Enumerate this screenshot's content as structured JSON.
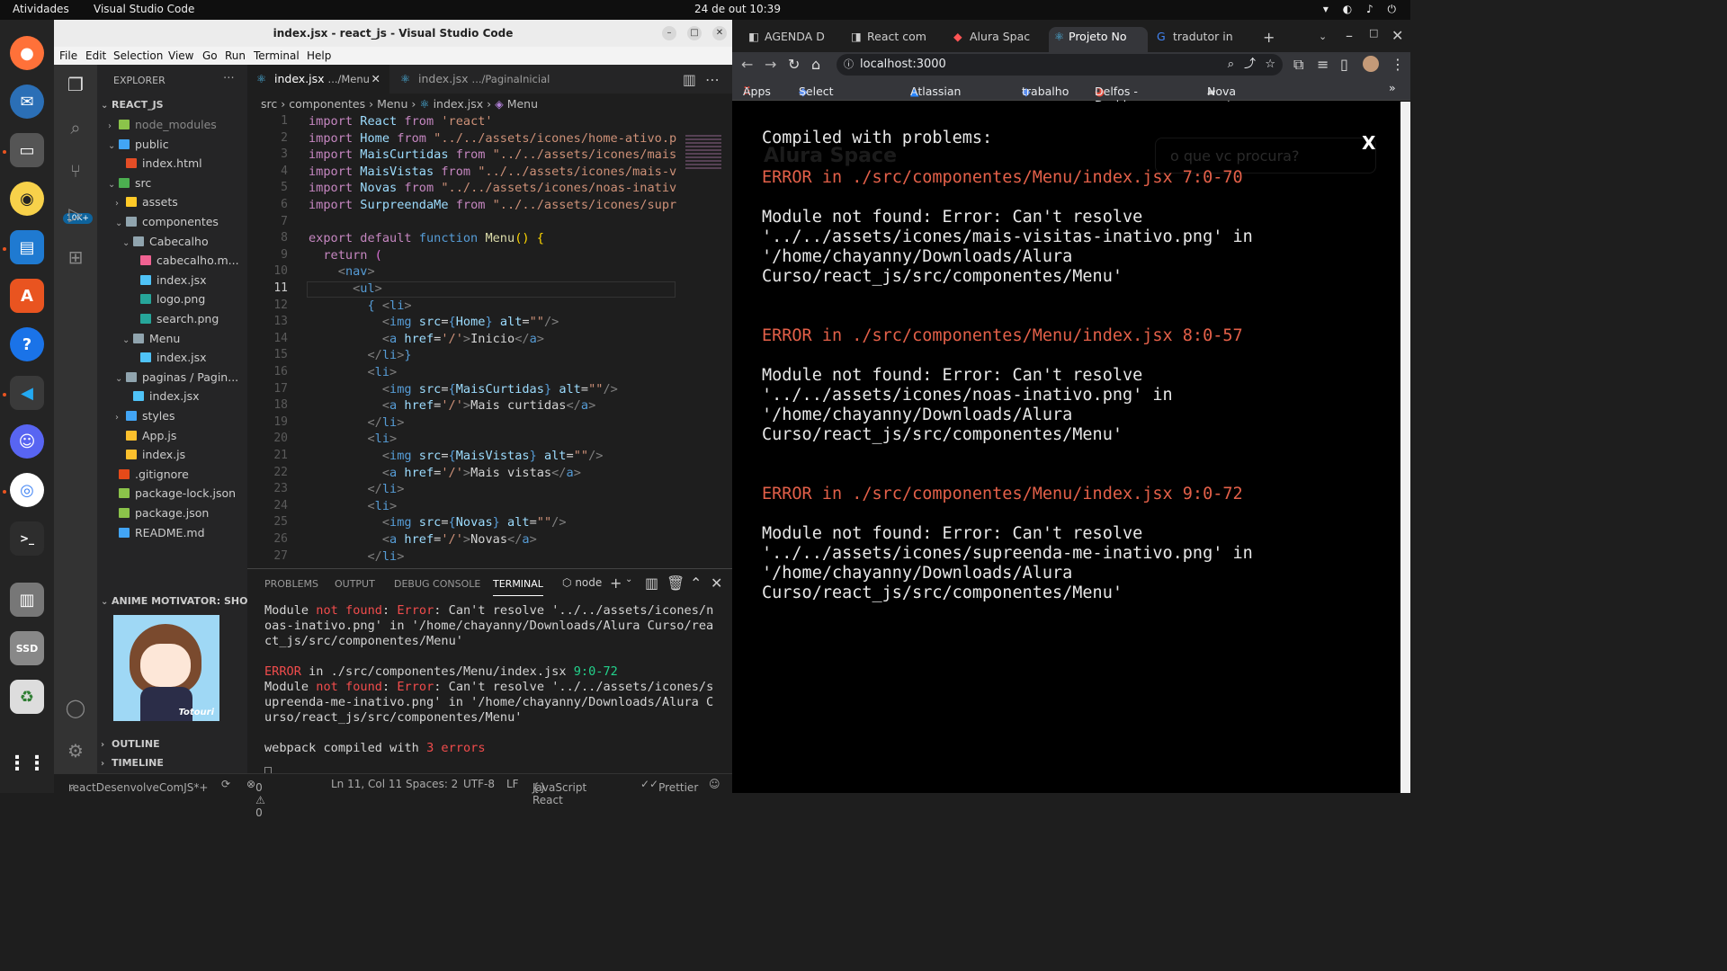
{
  "topbar": {
    "activities": "Atividades",
    "app_name": "Visual Studio Code",
    "clock": "24 de out  10:39"
  },
  "vscode": {
    "title": "index.jsx - react_js - Visual Studio Code",
    "menu": [
      "File",
      "Edit",
      "Selection",
      "View",
      "Go",
      "Run",
      "Terminal",
      "Help"
    ],
    "badge": "10K+",
    "explorer": {
      "header": "EXPLORER",
      "root": "REACT_JS",
      "tree": [
        {
          "label": "node_modules",
          "depth": 1,
          "kind": "folder",
          "open": false,
          "color": "#8bc34a"
        },
        {
          "label": "public",
          "depth": 1,
          "kind": "folder",
          "open": true,
          "color": "#42a5f5"
        },
        {
          "label": "index.html",
          "depth": 2,
          "kind": "file",
          "color": "#e44d26"
        },
        {
          "label": "src",
          "depth": 1,
          "kind": "folder",
          "open": true,
          "color": "#4caf50"
        },
        {
          "label": "assets",
          "depth": 2,
          "kind": "folder",
          "open": false,
          "color": "#ffca28"
        },
        {
          "label": "componentes",
          "depth": 2,
          "kind": "folder",
          "open": true,
          "color": "#90a4ae"
        },
        {
          "label": "Cabecalho",
          "depth": 3,
          "kind": "folder",
          "open": true,
          "color": "#90a4ae"
        },
        {
          "label": "cabecalho.m...",
          "depth": 4,
          "kind": "file",
          "color": "#f06292"
        },
        {
          "label": "index.jsx",
          "depth": 4,
          "kind": "file",
          "color": "#4fc3f7"
        },
        {
          "label": "logo.png",
          "depth": 4,
          "kind": "file",
          "color": "#26a69a"
        },
        {
          "label": "search.png",
          "depth": 4,
          "kind": "file",
          "color": "#26a69a"
        },
        {
          "label": "Menu",
          "depth": 3,
          "kind": "folder",
          "open": true,
          "color": "#90a4ae"
        },
        {
          "label": "index.jsx",
          "depth": 4,
          "kind": "file",
          "color": "#4fc3f7"
        },
        {
          "label": "paginas / Pagin...",
          "depth": 2,
          "kind": "folder",
          "open": true,
          "color": "#90a4ae"
        },
        {
          "label": "index.jsx",
          "depth": 3,
          "kind": "file",
          "color": "#4fc3f7"
        },
        {
          "label": "styles",
          "depth": 2,
          "kind": "folder",
          "open": false,
          "color": "#42a5f5"
        },
        {
          "label": "App.js",
          "depth": 2,
          "kind": "file",
          "color": "#fbc02d"
        },
        {
          "label": "index.js",
          "depth": 2,
          "kind": "file",
          "color": "#fbc02d"
        },
        {
          "label": ".gitignore",
          "depth": 1,
          "kind": "file",
          "color": "#e64a19"
        },
        {
          "label": "package-lock.json",
          "depth": 1,
          "kind": "file",
          "color": "#8bc34a"
        },
        {
          "label": "package.json",
          "depth": 1,
          "kind": "file",
          "color": "#8bc34a"
        },
        {
          "label": "README.md",
          "depth": 1,
          "kind": "file",
          "color": "#42a5f5"
        }
      ],
      "anime_header": "ANIME MOTIVATOR: SHOW",
      "anime_caption": "Totouri",
      "outline": "OUTLINE",
      "timeline": "TIMELINE"
    },
    "tabs": [
      {
        "name": "index.jsx",
        "path": ".../Menu",
        "active": true
      },
      {
        "name": "index.jsx",
        "path": ".../PaginaInicial",
        "active": false
      }
    ],
    "breadcrumb": [
      "src",
      "componentes",
      "Menu",
      "index.jsx",
      "Menu"
    ],
    "code_lines": [
      [
        [
          "k",
          "import "
        ],
        [
          "v",
          "React "
        ],
        [
          "k",
          "from "
        ],
        [
          "s",
          "'react'"
        ]
      ],
      [
        [
          "k",
          "import "
        ],
        [
          "v",
          "Home "
        ],
        [
          "k",
          "from "
        ],
        [
          "s",
          "\"../../assets/icones/home-ativo.p"
        ]
      ],
      [
        [
          "k",
          "import "
        ],
        [
          "v",
          "MaisCurtidas "
        ],
        [
          "k",
          "from "
        ],
        [
          "s",
          "\"../../assets/icones/mais"
        ]
      ],
      [
        [
          "k",
          "import "
        ],
        [
          "v",
          "MaisVistas "
        ],
        [
          "k",
          "from "
        ],
        [
          "s",
          "\"../../assets/icones/mais-v"
        ]
      ],
      [
        [
          "k",
          "import "
        ],
        [
          "v",
          "Novas "
        ],
        [
          "k",
          "from "
        ],
        [
          "s",
          "\"../../assets/icones/noas-inativ"
        ]
      ],
      [
        [
          "k",
          "import "
        ],
        [
          "v",
          "SurpreendaMe "
        ],
        [
          "k",
          "from "
        ],
        [
          "s",
          "\"../../assets/icones/supr"
        ]
      ],
      [],
      [
        [
          "k",
          "export default "
        ],
        [
          "t",
          "function "
        ],
        [
          "f",
          "Menu"
        ],
        [
          "y",
          "() {"
        ]
      ],
      [
        [
          "n",
          "  "
        ],
        [
          "k",
          "return "
        ],
        [
          "b",
          "("
        ]
      ],
      [
        [
          "n",
          "    "
        ],
        [
          "d",
          "<"
        ],
        [
          "t",
          "nav"
        ],
        [
          "d",
          ">"
        ]
      ],
      [
        [
          "n",
          "      "
        ],
        [
          "d",
          "<"
        ],
        [
          "t",
          "ul"
        ],
        [
          "d",
          ">"
        ]
      ],
      [
        [
          "n",
          "        "
        ],
        [
          "t",
          "{ "
        ],
        [
          "d",
          "<"
        ],
        [
          "t",
          "li"
        ],
        [
          "d",
          ">"
        ]
      ],
      [
        [
          "n",
          "          "
        ],
        [
          "d",
          "<"
        ],
        [
          "t",
          "img "
        ],
        [
          "v",
          "src"
        ],
        [
          "n",
          "="
        ],
        [
          "t",
          "{"
        ],
        [
          "v",
          "Home"
        ],
        [
          "t",
          "} "
        ],
        [
          "v",
          "alt"
        ],
        [
          "n",
          "="
        ],
        [
          "s",
          "\"\""
        ],
        [
          "d",
          "/>"
        ]
      ],
      [
        [
          "n",
          "          "
        ],
        [
          "d",
          "<"
        ],
        [
          "t",
          "a "
        ],
        [
          "v",
          "href"
        ],
        [
          "n",
          "="
        ],
        [
          "s",
          "'/'"
        ],
        [
          "d",
          ">"
        ],
        [
          "n",
          "Inicio"
        ],
        [
          "d",
          "</"
        ],
        [
          "t",
          "a"
        ],
        [
          "d",
          ">"
        ]
      ],
      [
        [
          "n",
          "        "
        ],
        [
          "d",
          "</"
        ],
        [
          "t",
          "li"
        ],
        [
          "d",
          ">"
        ],
        [
          "t",
          "}"
        ]
      ],
      [
        [
          "n",
          "        "
        ],
        [
          "d",
          "<"
        ],
        [
          "t",
          "li"
        ],
        [
          "d",
          ">"
        ]
      ],
      [
        [
          "n",
          "          "
        ],
        [
          "d",
          "<"
        ],
        [
          "t",
          "img "
        ],
        [
          "v",
          "src"
        ],
        [
          "n",
          "="
        ],
        [
          "t",
          "{"
        ],
        [
          "v",
          "MaisCurtidas"
        ],
        [
          "t",
          "} "
        ],
        [
          "v",
          "alt"
        ],
        [
          "n",
          "="
        ],
        [
          "s",
          "\"\""
        ],
        [
          "d",
          "/>"
        ]
      ],
      [
        [
          "n",
          "          "
        ],
        [
          "d",
          "<"
        ],
        [
          "t",
          "a "
        ],
        [
          "v",
          "href"
        ],
        [
          "n",
          "="
        ],
        [
          "s",
          "'/'"
        ],
        [
          "d",
          ">"
        ],
        [
          "n",
          "Mais curtidas"
        ],
        [
          "d",
          "</"
        ],
        [
          "t",
          "a"
        ],
        [
          "d",
          ">"
        ]
      ],
      [
        [
          "n",
          "        "
        ],
        [
          "d",
          "</"
        ],
        [
          "t",
          "li"
        ],
        [
          "d",
          ">"
        ]
      ],
      [
        [
          "n",
          "        "
        ],
        [
          "d",
          "<"
        ],
        [
          "t",
          "li"
        ],
        [
          "d",
          ">"
        ]
      ],
      [
        [
          "n",
          "          "
        ],
        [
          "d",
          "<"
        ],
        [
          "t",
          "img "
        ],
        [
          "v",
          "src"
        ],
        [
          "n",
          "="
        ],
        [
          "t",
          "{"
        ],
        [
          "v",
          "MaisVistas"
        ],
        [
          "t",
          "} "
        ],
        [
          "v",
          "alt"
        ],
        [
          "n",
          "="
        ],
        [
          "s",
          "\"\""
        ],
        [
          "d",
          "/>"
        ]
      ],
      [
        [
          "n",
          "          "
        ],
        [
          "d",
          "<"
        ],
        [
          "t",
          "a "
        ],
        [
          "v",
          "href"
        ],
        [
          "n",
          "="
        ],
        [
          "s",
          "'/'"
        ],
        [
          "d",
          ">"
        ],
        [
          "n",
          "Mais vistas"
        ],
        [
          "d",
          "</"
        ],
        [
          "t",
          "a"
        ],
        [
          "d",
          ">"
        ]
      ],
      [
        [
          "n",
          "        "
        ],
        [
          "d",
          "</"
        ],
        [
          "t",
          "li"
        ],
        [
          "d",
          ">"
        ]
      ],
      [
        [
          "n",
          "        "
        ],
        [
          "d",
          "<"
        ],
        [
          "t",
          "li"
        ],
        [
          "d",
          ">"
        ]
      ],
      [
        [
          "n",
          "          "
        ],
        [
          "d",
          "<"
        ],
        [
          "t",
          "img "
        ],
        [
          "v",
          "src"
        ],
        [
          "n",
          "="
        ],
        [
          "t",
          "{"
        ],
        [
          "v",
          "Novas"
        ],
        [
          "t",
          "} "
        ],
        [
          "v",
          "alt"
        ],
        [
          "n",
          "="
        ],
        [
          "s",
          "\"\""
        ],
        [
          "d",
          "/>"
        ]
      ],
      [
        [
          "n",
          "          "
        ],
        [
          "d",
          "<"
        ],
        [
          "t",
          "a "
        ],
        [
          "v",
          "href"
        ],
        [
          "n",
          "="
        ],
        [
          "s",
          "'/'"
        ],
        [
          "d",
          ">"
        ],
        [
          "n",
          "Novas"
        ],
        [
          "d",
          "</"
        ],
        [
          "t",
          "a"
        ],
        [
          "d",
          ">"
        ]
      ],
      [
        [
          "n",
          "        "
        ],
        [
          "d",
          "</"
        ],
        [
          "t",
          "li"
        ],
        [
          "d",
          ">"
        ]
      ]
    ],
    "panel_tabs": [
      "PROBLEMS",
      "OUTPUT",
      "DEBUG CONSOLE",
      "TERMINAL"
    ],
    "terminal_shell": "node",
    "terminal": [
      [
        [
          "n",
          "Module "
        ],
        [
          "r",
          "not found"
        ],
        [
          "n",
          ": "
        ],
        [
          "r",
          "Error"
        ],
        [
          "n",
          ": Can't resolve '../../assets/icones/n"
        ]
      ],
      [
        [
          "n",
          "oas-inativo.png' in '/home/chayanny/Downloads/Alura Curso/rea"
        ]
      ],
      [
        [
          "n",
          "ct_js/src/componentes/Menu'"
        ]
      ],
      [],
      [
        [
          "r",
          "ERROR"
        ],
        [
          "n",
          " in ./src/componentes/Menu/index.jsx "
        ],
        [
          "g",
          "9:0-72"
        ]
      ],
      [
        [
          "n",
          "Module "
        ],
        [
          "r",
          "not found"
        ],
        [
          "n",
          ": "
        ],
        [
          "r",
          "Error"
        ],
        [
          "n",
          ": Can't resolve '../../assets/icones/s"
        ]
      ],
      [
        [
          "n",
          "upreenda-me-inativo.png' in '/home/chayanny/Downloads/Alura C"
        ]
      ],
      [
        [
          "n",
          "urso/react_js/src/componentes/Menu'"
        ]
      ],
      [],
      [
        [
          "n",
          "webpack compiled with "
        ],
        [
          "r",
          "3 errors"
        ]
      ]
    ],
    "status": {
      "branch": "reactDesenvolveComJS*+",
      "problems": "0 ⚠ 0",
      "position": "Ln 11, Col 11",
      "spaces": "Spaces: 2",
      "encoding": "UTF-8",
      "eol": "LF",
      "language": "JavaScript React",
      "prettier": "Prettier"
    }
  },
  "chrome": {
    "tabs": [
      "AGENDA D",
      "React com",
      "Alura Spac",
      "Projeto No",
      "tradutor in"
    ],
    "active_tab": 3,
    "url": "localhost:3000",
    "bookmarks": [
      "Apps",
      "Select some to...",
      "Atlassian acco...",
      "trabalho",
      "Delfos - Dashb...",
      "Nova pasta"
    ],
    "overlay": {
      "heading": "Compiled with problems:",
      "close": "X",
      "errors": [
        {
          "title": "ERROR in ./src/componentes/Menu/index.jsx 7:0-70",
          "lines": [
            "Module not found: Error: Can't resolve",
            "'../../assets/icones/mais-visitas-inativo.png' in",
            "'/home/chayanny/Downloads/Alura",
            "Curso/react_js/src/componentes/Menu'"
          ]
        },
        {
          "title": "ERROR in ./src/componentes/Menu/index.jsx 8:0-57",
          "lines": [
            "Module not found: Error: Can't resolve",
            "'../../assets/icones/noas-inativo.png' in",
            "'/home/chayanny/Downloads/Alura",
            "Curso/react_js/src/componentes/Menu'"
          ]
        },
        {
          "title": "ERROR in ./src/componentes/Menu/index.jsx 9:0-72",
          "lines": [
            "Module not found: Error: Can't resolve",
            "'../../assets/icones/supreenda-me-inativo.png' in",
            "'/home/chayanny/Downloads/Alura",
            "Curso/react_js/src/componentes/Menu'"
          ]
        }
      ],
      "ghost_search": "o que vc procura?",
      "ghost_logo": "Alura Space"
    }
  }
}
